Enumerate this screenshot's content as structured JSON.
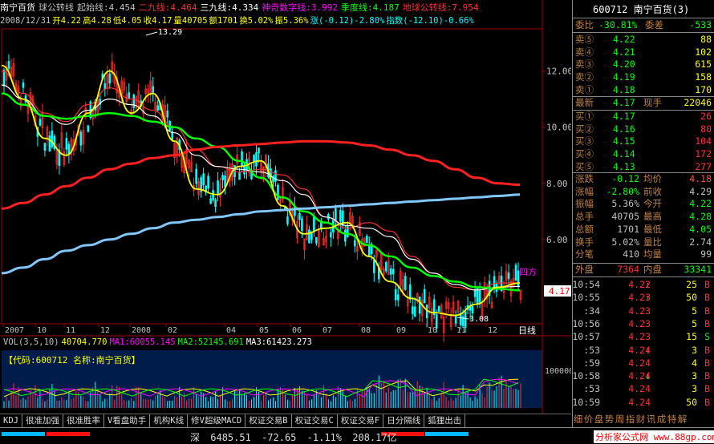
{
  "stock": {
    "name": "南宁百货",
    "code": "600712",
    "code_full": "600712 南宁百货(3)"
  },
  "indicator_row": [
    {
      "text": "南宁百货",
      "color": "#ffffff"
    },
    {
      "text": "球公转线",
      "color": "#c0c0c0"
    },
    {
      "text": "起始线:4.454",
      "color": "#c0c0c0"
    },
    {
      "text": "二九线:4.464",
      "color": "#ff3030"
    },
    {
      "text": "三九线:4.334",
      "color": "#ffffff"
    },
    {
      "text": "神奇数字线:3.992",
      "color": "#ff00ff"
    },
    {
      "text": "季度线:4.187",
      "color": "#00ff00"
    },
    {
      "text": "地球公转线:7.954",
      "color": "#ff3030"
    }
  ],
  "info_row": [
    {
      "text": "2008/12/31",
      "color": "#c0c0c0"
    },
    {
      "text": "开4.22",
      "color": "#ffff00"
    },
    {
      "text": "高4.28",
      "color": "#ffff00"
    },
    {
      "text": "低4.05",
      "color": "#ffff00"
    },
    {
      "text": "收4.17",
      "color": "#ffff00"
    },
    {
      "text": "量40705",
      "color": "#ffff00"
    },
    {
      "text": "额1701",
      "color": "#ffff00"
    },
    {
      "text": "换5.02%",
      "color": "#ffff00"
    },
    {
      "text": "振5.36%",
      "color": "#ffff00"
    },
    {
      "text": "涨(-0.12)-2.80%",
      "color": "#00ffff"
    },
    {
      "text": "指数(-12.10)-0.66%",
      "color": "#00ffff"
    }
  ],
  "price_axis": [
    "12.00",
    "10.00",
    "8.00",
    "6.00"
  ],
  "price_marker": "4.17",
  "date_axis": [
    "2007",
    "10",
    "11",
    "12",
    "2008",
    "02",
    "04",
    "05",
    "06",
    "07",
    "08",
    "09",
    "10",
    "11",
    "12"
  ],
  "period_label": "日线",
  "high_label": "13.29",
  "low_label": "3.08",
  "corner_label": "四方",
  "vol_row": [
    {
      "text": "VOL(3,5,10)",
      "color": "#c0c0c0"
    },
    {
      "text": "40704.770",
      "color": "#ffff00"
    },
    {
      "text": "MA1:60055.145",
      "color": "#ff00ff"
    },
    {
      "text": "MA2:52145.691",
      "color": "#00ff00"
    },
    {
      "text": "MA3:61423.273",
      "color": "#ffffff"
    }
  ],
  "vol_axis": "100000",
  "sub_panel": "【代码:600712 名称:南宁百货】",
  "tabs": [
    "KDJ",
    "很准加强",
    "很准胜率",
    "V看盘助手",
    "机构K线",
    "修V超级MACD",
    "权证交易B",
    "权证交易C",
    "权证交易F",
    "日分隔线",
    "狐狸出击"
  ],
  "status": {
    "market": "深",
    "index": "6485.51",
    "change": "-72.65",
    "pct": "-1.11%",
    "amount": "208.17亿"
  },
  "brand": "分析家公式网 www.88gp.com",
  "quote": {
    "weibi": {
      "label": "委比",
      "value": "-30.81%",
      "label2": "委差",
      "value2": "-533"
    },
    "sells": [
      {
        "label": "卖⑤",
        "price": "4.22",
        "vol": "88"
      },
      {
        "label": "卖④",
        "price": "4.21",
        "vol": "102"
      },
      {
        "label": "卖③",
        "price": "4.20",
        "vol": "615"
      },
      {
        "label": "卖②",
        "price": "4.19",
        "vol": "158"
      },
      {
        "label": "卖①",
        "price": "4.18",
        "vol": "170"
      }
    ],
    "latest": {
      "label": "最新",
      "value": "4.17",
      "label2": "现手",
      "value2": "22046"
    },
    "buys": [
      {
        "label": "买①",
        "price": "4.17",
        "vol": "26"
      },
      {
        "label": "买②",
        "price": "4.16",
        "vol": "80"
      },
      {
        "label": "买③",
        "price": "4.15",
        "vol": "104"
      },
      {
        "label": "买④",
        "price": "4.14",
        "vol": "172"
      },
      {
        "label": "买⑤",
        "price": "4.13",
        "vol": "277"
      }
    ],
    "stats": [
      {
        "l1": "涨跌",
        "v1": "-0.12",
        "c1": "#00ff00",
        "l2": "均价",
        "v2": "4.18",
        "c2": "#ff5050"
      },
      {
        "l1": "涨幅",
        "v1": "-2.80%",
        "c1": "#00ff00",
        "l2": "前收",
        "v2": "4.29",
        "c2": "#c0c0c0"
      },
      {
        "l1": "振幅",
        "v1": "5.36%",
        "c1": "#c0c0c0",
        "l2": "今开",
        "v2": "4.22",
        "c2": "#00ff00"
      },
      {
        "l1": "总手",
        "v1": "40705",
        "c1": "#c0c0c0",
        "l2": "最高",
        "v2": "4.28",
        "c2": "#00ff00"
      },
      {
        "l1": "总额",
        "v1": "1701",
        "c1": "#c0c0c0",
        "l2": "最低",
        "v2": "4.05",
        "c2": "#00ff00"
      },
      {
        "l1": "换手",
        "v1": "5.02%",
        "c1": "#c0c0c0",
        "l2": "量比",
        "v2": "2.74",
        "c2": "#c0c0c0"
      },
      {
        "l1": "分笔",
        "v1": "410",
        "c1": "#c0c0c0",
        "l2": "均量",
        "v2": "99",
        "c2": "#c0c0c0"
      }
    ],
    "outer": {
      "label": "外盘",
      "value": "7364",
      "label2": "内盘",
      "value2": "33341"
    },
    "ticks": [
      {
        "time": "10:54",
        "price": "4.22",
        "dir": "↑",
        "vol": "25",
        "bs": "B"
      },
      {
        "time": "10:55",
        "price": "4.23",
        "dir": "↑",
        "vol": "50",
        "bs": "B"
      },
      {
        "time": ":34",
        "price": "4.23",
        "dir": "",
        "vol": "5",
        "bs": "B"
      },
      {
        "time": "10:56",
        "price": "4.23",
        "dir": "",
        "vol": "5",
        "bs": "B"
      },
      {
        "time": "10:57",
        "price": "4.23",
        "dir": "",
        "vol": "15",
        "bs": "S"
      },
      {
        "time": ":53",
        "price": "4.24",
        "dir": "↑",
        "vol": "3",
        "bs": "B"
      },
      {
        "time": ":59",
        "price": "4.24",
        "dir": "",
        "vol": "4",
        "bs": "B"
      },
      {
        "time": "10:58",
        "price": "4.24",
        "dir": "↓",
        "vol": "3",
        "bs": "B"
      },
      {
        "time": ":53",
        "price": "4.24",
        "dir": "",
        "vol": "3",
        "bs": "B"
      },
      {
        "time": "10:59",
        "price": "4.24",
        "dir": "",
        "vol": "50",
        "bs": "B"
      }
    ],
    "bottom_tabs": [
      "细",
      "价",
      "盘",
      "势",
      "周",
      "指",
      "财",
      "讯",
      "成",
      "特",
      "解"
    ]
  },
  "chart_data": {
    "type": "line",
    "period": "daily",
    "x": [
      "2007",
      "10",
      "11",
      "12",
      "2008",
      "02",
      "04",
      "05",
      "06",
      "07",
      "08",
      "09",
      "10",
      "11",
      "12"
    ],
    "ylim": [
      3.0,
      13.5
    ],
    "yticks": [
      12.0,
      10.0,
      8.0,
      6.0
    ],
    "annotations": [
      {
        "text": "13.29",
        "value": 13.29
      },
      {
        "text": "3.08",
        "value": 3.08
      }
    ],
    "series": [
      {
        "name": "二九线",
        "color": "#ff3030",
        "values": [
          12.0,
          11.2,
          10.5,
          10.2,
          10.8,
          11.4,
          11.0,
          10.6,
          10.0,
          9.2,
          8.6,
          8.4,
          8.5,
          8.3,
          7.8,
          6.8,
          6.4,
          6.6,
          6.3,
          5.4,
          4.8,
          4.3,
          4.2,
          4.45,
          4.46
        ]
      },
      {
        "name": "三九线",
        "color": "#ffffff",
        "values": [
          11.5,
          11.0,
          10.4,
          10.1,
          10.6,
          11.0,
          10.8,
          10.4,
          9.8,
          9.0,
          8.6,
          8.5,
          8.4,
          8.1,
          7.6,
          6.8,
          6.5,
          6.4,
          6.1,
          5.3,
          4.8,
          4.4,
          4.2,
          4.3,
          4.33
        ]
      },
      {
        "name": "季度线",
        "color": "#00ff00",
        "values": [
          11.2,
          10.8,
          10.4,
          10.3,
          10.4,
          10.5,
          10.4,
          10.2,
          10.0,
          9.6,
          9.3,
          8.8,
          8.2,
          7.5,
          7.0,
          6.6,
          6.2,
          5.8,
          5.4,
          5.0,
          4.7,
          4.5,
          4.3,
          4.25,
          4.19
        ]
      },
      {
        "name": "地球公转线",
        "color": "#ff2020",
        "values": [
          7.1,
          7.3,
          7.6,
          7.9,
          8.2,
          8.5,
          8.7,
          8.9,
          9.0,
          9.2,
          9.3,
          9.35,
          9.4,
          9.45,
          9.5,
          9.5,
          9.45,
          9.35,
          9.2,
          9.0,
          8.8,
          8.5,
          8.2,
          8.0,
          7.95
        ]
      },
      {
        "name": "起始线",
        "color": "#ffff00",
        "values": [
          12.2,
          11.0,
          9.6,
          9.0,
          10.5,
          12.0,
          10.5,
          11.2,
          9.5,
          7.8,
          7.6,
          8.6,
          8.8,
          7.2,
          6.2,
          6.4,
          6.6,
          5.4,
          4.5,
          3.9,
          3.4,
          3.3,
          3.7,
          4.3,
          4.45
        ]
      },
      {
        "name": "",
        "color": "#80c8ff",
        "values": [
          4.8,
          5.0,
          5.3,
          5.6,
          5.8,
          6.0,
          6.2,
          6.4,
          6.6,
          6.7,
          6.8,
          6.9,
          7.0,
          7.05,
          7.1,
          7.15,
          7.2,
          7.25,
          7.3,
          7.35,
          7.4,
          7.45,
          7.5,
          7.55,
          7.6
        ]
      }
    ],
    "volume": {
      "ylim": [
        0,
        130000
      ],
      "yticks": [
        100000
      ],
      "last": 40704.77
    }
  }
}
